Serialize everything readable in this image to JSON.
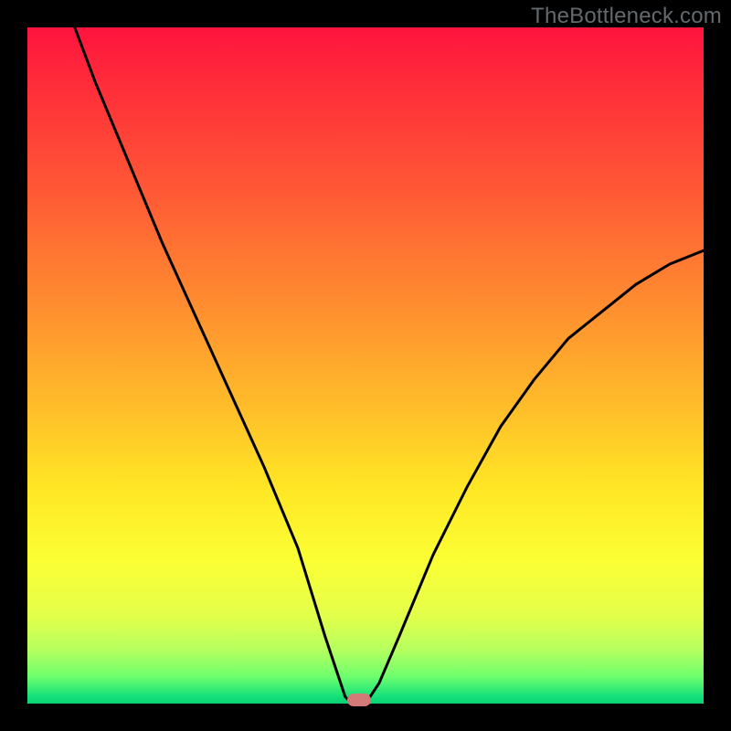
{
  "attribution": "TheBottleneck.com",
  "chart_data": {
    "type": "line",
    "title": "",
    "xlabel": "",
    "ylabel": "",
    "xlim": [
      0,
      100
    ],
    "ylim": [
      0,
      100
    ],
    "grid": false,
    "legend": false,
    "series": [
      {
        "name": "bottleneck-curve",
        "x": [
          7,
          10,
          15,
          20,
          25,
          30,
          35,
          40,
          44,
          46,
          47,
          48,
          49,
          50,
          52,
          55,
          60,
          65,
          70,
          75,
          80,
          85,
          90,
          95,
          100
        ],
        "y": [
          100,
          92,
          80,
          68,
          57,
          46,
          35,
          23,
          10,
          4,
          1,
          0,
          0,
          0,
          3,
          10,
          22,
          32,
          41,
          48,
          54,
          58,
          62,
          65,
          67
        ]
      }
    ],
    "marker": {
      "x": 49,
      "y": 0.5,
      "color": "#d37a79"
    },
    "background_gradient": {
      "stops": [
        {
          "pos": 0,
          "color": "#ff143e"
        },
        {
          "pos": 25,
          "color": "#ff5b35"
        },
        {
          "pos": 55,
          "color": "#ffb92a"
        },
        {
          "pos": 79,
          "color": "#fbff34"
        },
        {
          "pos": 96,
          "color": "#6eff6e"
        },
        {
          "pos": 100,
          "color": "#09d074"
        }
      ]
    }
  }
}
